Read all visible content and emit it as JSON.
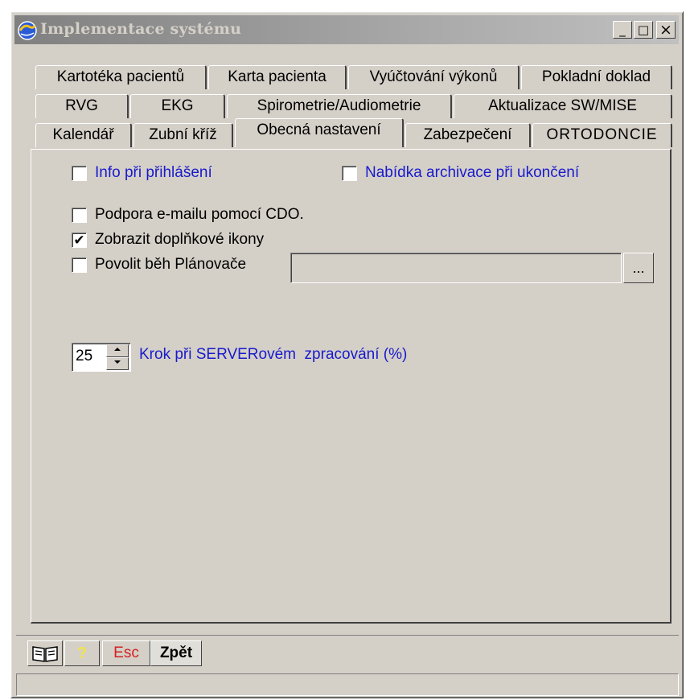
{
  "window": {
    "title": "Implementace systému",
    "minimize_glyph": "_",
    "maximize_glyph": "□",
    "close_glyph": "×"
  },
  "tabs": {
    "row1": [
      "Kartotéka pacientů",
      "Karta pacienta",
      "Vyúčtování výkonů",
      "Pokladní doklad"
    ],
    "row2": [
      "RVG",
      "EKG",
      "Spirometrie/Audiometrie",
      "Aktualizace SW/MISE"
    ],
    "row3": [
      "Kalendář",
      "Zubní kříž",
      "Obecná nastavení",
      "Zabezpečení",
      "ORTODONCIE"
    ],
    "active": "Obecná nastavení"
  },
  "settings": {
    "info_login": {
      "label": "Info při přihlášení",
      "checked": false
    },
    "archive_offer": {
      "label": "Nabídka archivace při ukončení",
      "checked": false
    },
    "email_cdo": {
      "label": "Podpora e-mailu pomocí CDO.",
      "checked": false
    },
    "extra_icons": {
      "label": "Zobrazit doplňkové ikony",
      "checked": true
    },
    "scheduler": {
      "label": "Povolit běh Plánovače",
      "checked": false,
      "path": ""
    },
    "browse_label": "...",
    "check_glyph": "✔"
  },
  "server_step": {
    "value": "25",
    "label": "Krok při SERVERovém  zpracování (%)"
  },
  "toolbar": {
    "book_icon": "book-icon",
    "help_icon": "help-icon",
    "help_glyph": "?",
    "esc_label": "Esc",
    "back_label": "Zpět"
  },
  "colors": {
    "accent_blue": "#1a1acc",
    "esc_red": "#d42020"
  }
}
